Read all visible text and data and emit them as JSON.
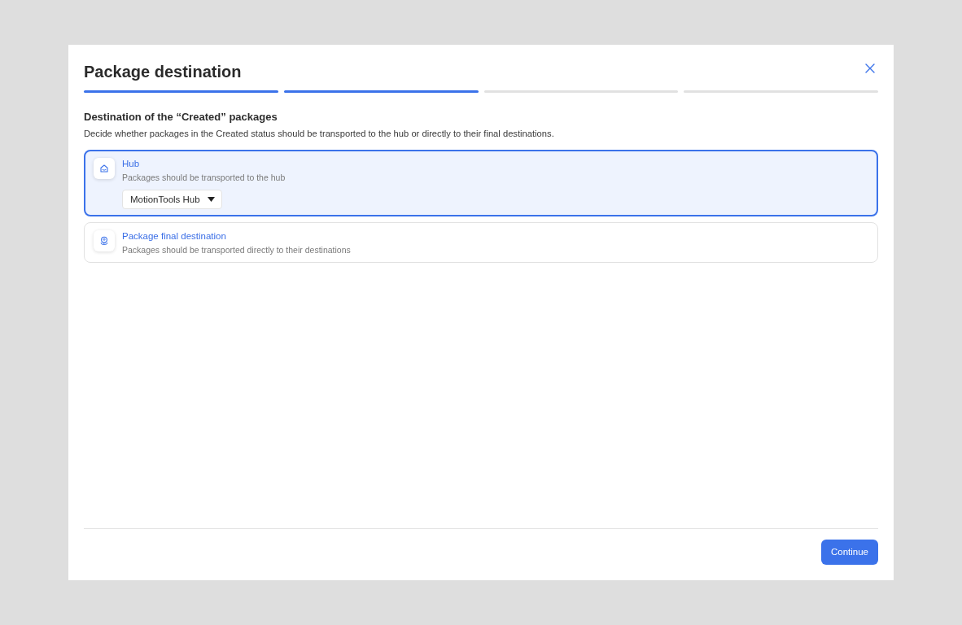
{
  "dialog": {
    "title": "Package destination"
  },
  "steps": [
    {
      "completed": true
    },
    {
      "completed": true
    },
    {
      "completed": false
    },
    {
      "completed": false
    }
  ],
  "section": {
    "heading": "Destination of the “Created” packages",
    "description": "Decide whether packages in the Created status should be transported to the hub or directly to their final destinations."
  },
  "options": [
    {
      "title": "Hub",
      "description": "Packages should be transported to the hub",
      "selected": true,
      "dropdown": {
        "value": "MotionTools Hub"
      }
    },
    {
      "title": "Package final destination",
      "description": "Packages should be transported directly to their destinations",
      "selected": false
    }
  ],
  "footer": {
    "button": "Continue"
  }
}
